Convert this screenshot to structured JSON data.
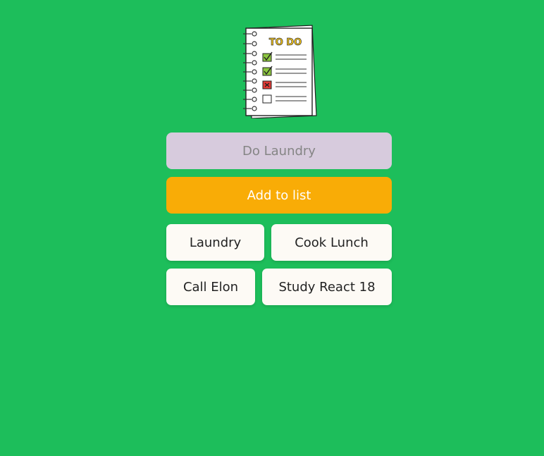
{
  "logo": {
    "title": "TO DO",
    "icon": "todo-notepad-icon",
    "items": [
      {
        "state": "checked",
        "color": "#8cc63f"
      },
      {
        "state": "checked",
        "color": "#8cc63f"
      },
      {
        "state": "crossed",
        "color": "#e53935"
      },
      {
        "state": "empty",
        "color": "#ffffff"
      }
    ]
  },
  "input": {
    "placeholder": "Do Laundry",
    "value": ""
  },
  "add_button": {
    "label": "Add to list"
  },
  "todos": [
    {
      "label": "Laundry"
    },
    {
      "label": "Cook Lunch"
    },
    {
      "label": "Call Elon"
    },
    {
      "label": "Study React 18"
    }
  ],
  "colors": {
    "background": "#1dbe5b",
    "input_bg": "#d7cbdd",
    "button_bg": "#f9ac06",
    "item_bg": "#fdfaf5"
  }
}
